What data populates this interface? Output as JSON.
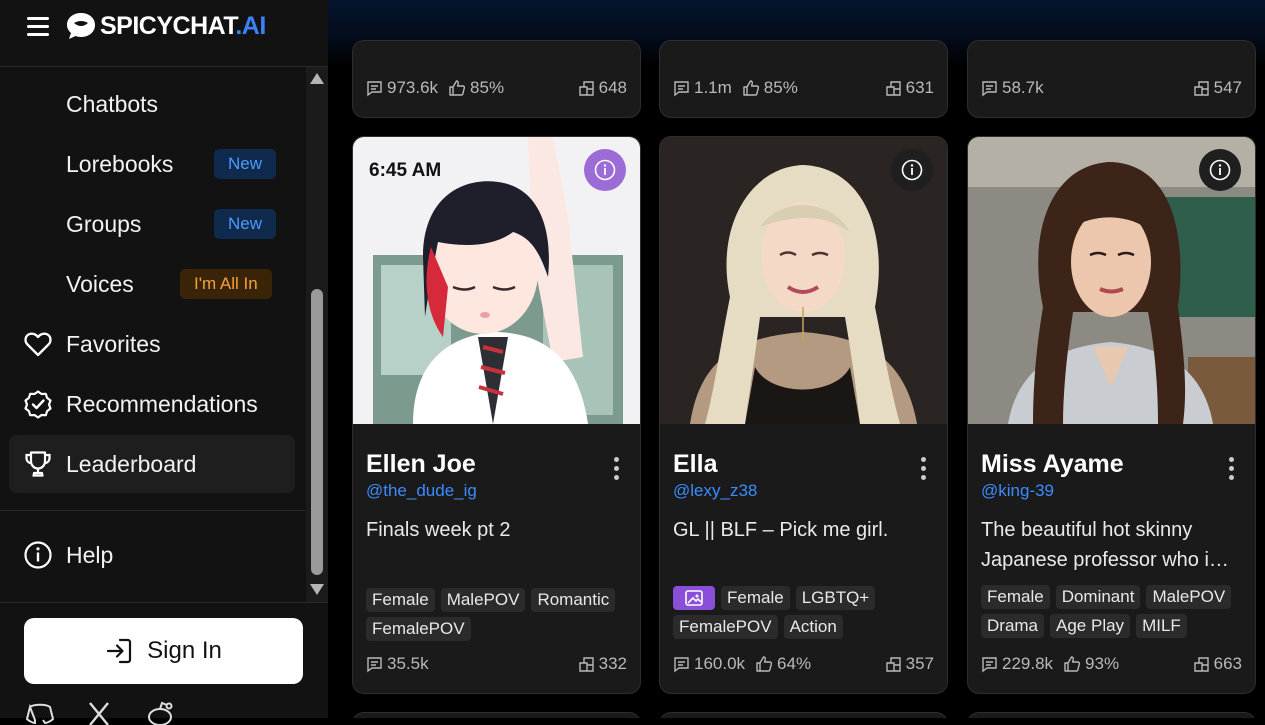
{
  "app": {
    "logo_main": "SPICYCHAT",
    "logo_ai": ".AI"
  },
  "sidebar": {
    "items": [
      {
        "label": "Chatbots",
        "badge": ""
      },
      {
        "label": "Lorebooks",
        "badge": "New"
      },
      {
        "label": "Groups",
        "badge": "New"
      },
      {
        "label": "Voices",
        "badge": "I'm All In"
      },
      {
        "label": "Favorites",
        "icon": "heart-icon"
      },
      {
        "label": "Recommendations",
        "icon": "check-badge-icon"
      },
      {
        "label": "Leaderboard",
        "icon": "trophy-icon",
        "active": true
      }
    ],
    "help_label": "Help",
    "signin_label": "Sign In",
    "social_icons": [
      "discord-icon",
      "x-icon",
      "reddit-icon"
    ]
  },
  "top_cards": [
    {
      "messages": "973.6k",
      "rating": "85%",
      "chats": "648"
    },
    {
      "messages": "1.1m",
      "rating": "85%",
      "chats": "631"
    },
    {
      "messages": "58.7k",
      "rating": "",
      "chats": "547"
    }
  ],
  "cards": [
    {
      "name": "Ellen Joe",
      "handle": "@the_dude_ig",
      "description": "Finals week pt 2",
      "image_time_text": "6:45 AM",
      "tags": [
        "Female",
        "MalePOV",
        "Romantic",
        "FemalePOV"
      ],
      "messages": "35.5k",
      "rating": "",
      "chats": "332"
    },
    {
      "name": "Ella",
      "handle": "@lexy_z38",
      "description": "GL || BLF – Pick me girl.",
      "tags": [
        "Female",
        "LGBTQ+",
        "FemalePOV",
        "Action"
      ],
      "messages": "160.0k",
      "rating": "64%",
      "chats": "357"
    },
    {
      "name": "Miss Ayame",
      "handle": "@king-39",
      "description": "The beautiful hot skinny Japanese professor who i…",
      "tags": [
        "Female",
        "Dominant",
        "MalePOV",
        "Drama",
        "Age Play",
        "MILF"
      ],
      "messages": "229.8k",
      "rating": "93%",
      "chats": "663"
    }
  ],
  "colors": {
    "accent_blue": "#3b82f6",
    "badge_new_text": "#4b9bff",
    "badge_allin_text": "#f5a03a",
    "image_tag_purple": "#8a4fd9"
  }
}
